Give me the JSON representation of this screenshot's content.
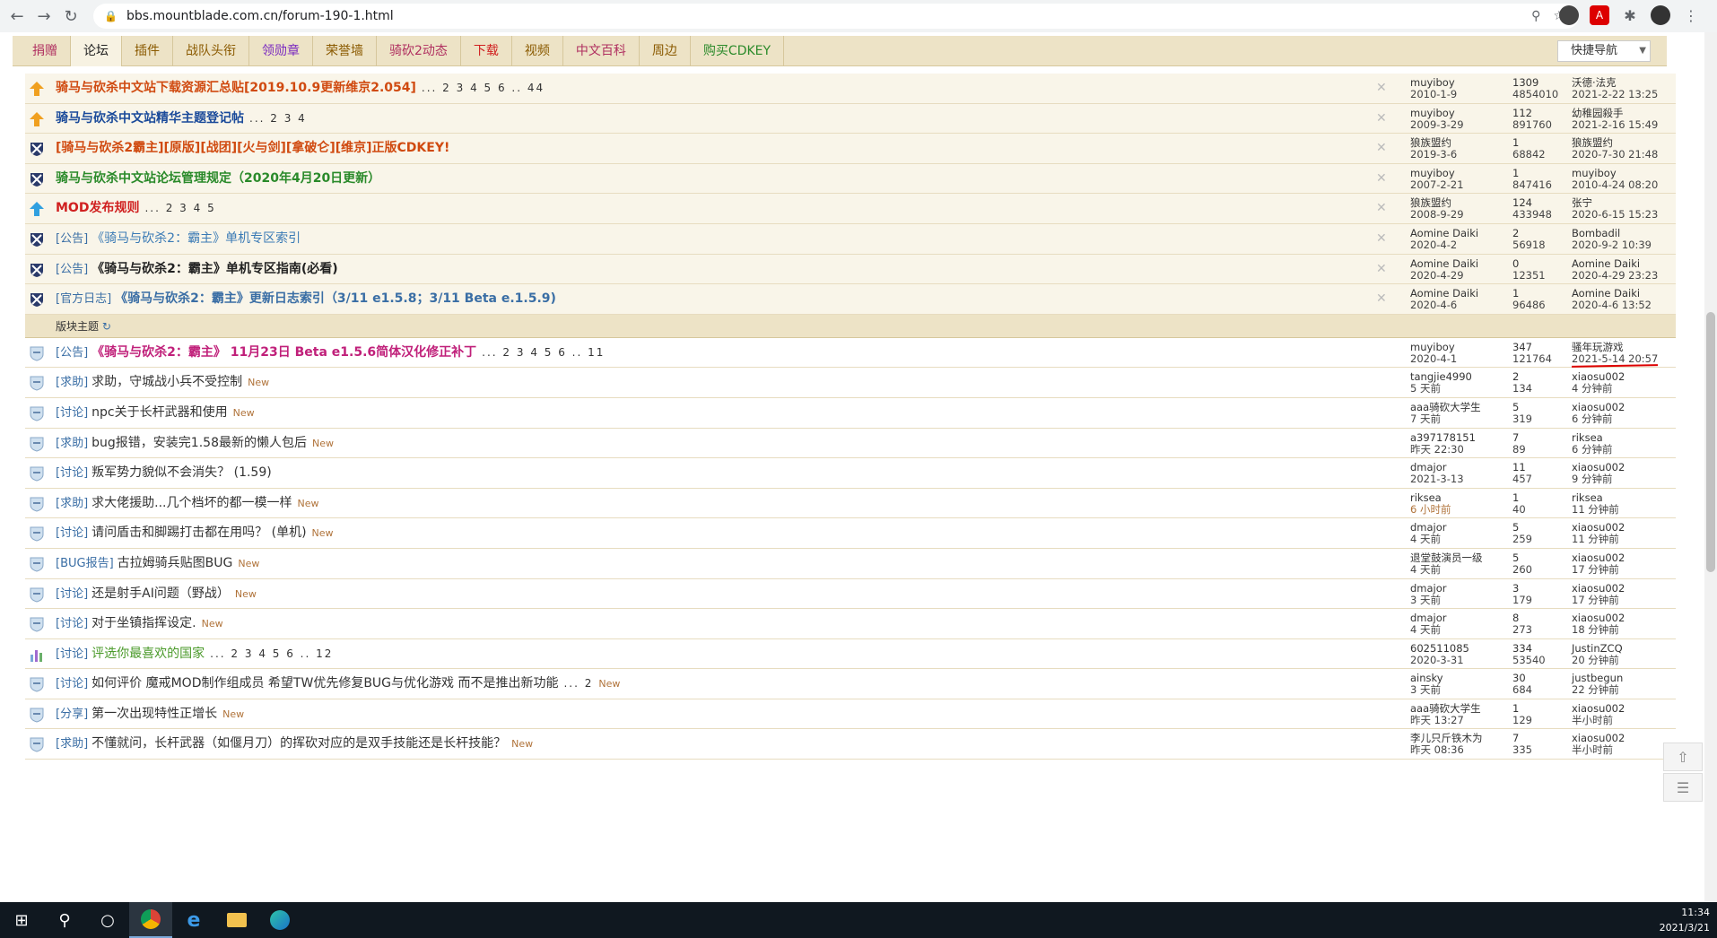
{
  "browser": {
    "url": "bbs.mountblade.com.cn/forum-190-1.html"
  },
  "topnav": {
    "items": [
      {
        "label": "捐赠",
        "color": "#b03060"
      },
      {
        "label": "论坛",
        "color": "#222222"
      },
      {
        "label": "插件",
        "color": "#8a5a00"
      },
      {
        "label": "战队头衔",
        "color": "#8a5a00"
      },
      {
        "label": "领勋章",
        "color": "#7a2ac0"
      },
      {
        "label": "荣誉墙",
        "color": "#8a5a00"
      },
      {
        "label": "骑砍2动态",
        "color": "#b03060"
      },
      {
        "label": "下载",
        "color": "#d02020"
      },
      {
        "label": "视频",
        "color": "#8a5a00"
      },
      {
        "label": "中文百科",
        "color": "#b03060"
      },
      {
        "label": "周边",
        "color": "#8a5a00"
      },
      {
        "label": "购买CDKEY",
        "color": "#2a8a2a"
      }
    ],
    "quick_nav": "快捷导航"
  },
  "sticky_threads": [
    {
      "title": "骑马与砍杀中文站下载资源汇总贴[2019.10.9更新维京2.054]",
      "title_color": "#d04a10",
      "bold": true,
      "pages": "... 2 3 4 5 6 .. 44",
      "author": "muyiboy",
      "date": "2010-1-9",
      "replies": "1309",
      "views": "4854010",
      "last_user": "沃德·法克",
      "last_time": "2021-2-22 13:25",
      "icon": "up-orange"
    },
    {
      "title": "骑马与砍杀中文站精华主题登记帖",
      "title_color": "#1a4a9a",
      "bold": true,
      "pages": "... 2 3 4",
      "author": "muyiboy",
      "date": "2009-3-29",
      "replies": "112",
      "views": "891760",
      "last_user": "幼稚园殺手",
      "last_time": "2021-2-16 15:49",
      "icon": "up-orange"
    },
    {
      "title": "[骑马与砍杀2霸主][原版][战团][火与剑][拿破仑][维京]正版CDKEY!",
      "title_color": "#d04a10",
      "bold": true,
      "pages": "",
      "author": "狼族盟约",
      "date": "2019-3-6",
      "replies": "1",
      "views": "68842",
      "last_user": "狼族盟约",
      "last_time": "2020-7-30 21:48",
      "icon": "shield-dark"
    },
    {
      "title": "骑马与砍杀中文站论坛管理规定（2020年4月20日更新）",
      "title_color": "#2a8a2a",
      "bold": true,
      "pages": "",
      "author": "muyiboy",
      "date": "2007-2-21",
      "replies": "1",
      "views": "847416",
      "last_user": "muyiboy",
      "last_time": "2010-4-24 08:20",
      "icon": "shield-dark"
    },
    {
      "title": "MOD发布规则",
      "title_color": "#d02020",
      "bold": true,
      "pages": "... 2 3 4 5",
      "author": "狼族盟约",
      "date": "2008-9-29",
      "replies": "124",
      "views": "433948",
      "last_user": "张宁",
      "last_time": "2020-6-15 15:23",
      "icon": "up-blue"
    },
    {
      "tag": "[公告]",
      "title": "《骑马与砍杀2：霸主》单机专区索引",
      "title_color": "#3a7ab5",
      "bold": false,
      "pages": "",
      "author": "Aomine Daiki",
      "date": "2020-4-2",
      "replies": "2",
      "views": "56918",
      "last_user": "Bombadil",
      "last_time": "2020-9-2 10:39",
      "icon": "shield-dark"
    },
    {
      "tag": "[公告]",
      "title": "《骑马与砍杀2：霸主》单机专区指南(必看)",
      "title_color": "#222222",
      "bold": true,
      "pages": "",
      "author": "Aomine Daiki",
      "date": "2020-4-29",
      "replies": "0",
      "views": "12351",
      "last_user": "Aomine Daiki",
      "last_time": "2020-4-29 23:23",
      "icon": "shield-dark"
    },
    {
      "tag": "[官方日志]",
      "title": "《骑马与砍杀2：霸主》更新日志索引（3/11 e1.5.8；3/11 Beta e.1.5.9)",
      "title_color": "#3a6ea5",
      "bold": true,
      "pages": "",
      "author": "Aomine Daiki",
      "date": "2020-4-6",
      "replies": "1",
      "views": "96486",
      "last_user": "Aomine Daiki",
      "last_time": "2020-4-6 13:52",
      "icon": "shield-dark"
    }
  ],
  "section_label": "版块主题",
  "threads": [
    {
      "tag": "[公告]",
      "title": "《骑马与砍杀2：霸主》 11月23日 Beta e1.5.6简体汉化修正补丁",
      "title_color": "#c0207a",
      "bold": true,
      "pages": "... 2 3 4 5 6 .. 11",
      "author": "muyiboy",
      "date": "2020-4-1",
      "date_orange": false,
      "replies": "347",
      "views": "121764",
      "last_user": "骚年玩游戏",
      "last_time": "2021-5-14 20:57",
      "new": "",
      "highlight_last": true
    },
    {
      "tag": "[求助]",
      "title": "求助，守城战小兵不受控制",
      "title_color": "#333333",
      "bold": false,
      "pages": "",
      "author": "tangjie4990",
      "date": "5 天前",
      "date_orange": false,
      "replies": "2",
      "views": "134",
      "last_user": "xiaosu002",
      "last_time": "4 分钟前",
      "new": "New"
    },
    {
      "tag": "[讨论]",
      "title": "npc关于长杆武器和使用",
      "title_color": "#333333",
      "bold": false,
      "pages": "",
      "author": "aaa骑砍大学生",
      "date": "7 天前",
      "date_orange": false,
      "replies": "5",
      "views": "319",
      "last_user": "xiaosu002",
      "last_time": "6 分钟前",
      "new": "New"
    },
    {
      "tag": "[求助]",
      "title": "bug报错，安装完1.58最新的懒人包后",
      "title_color": "#333333",
      "bold": false,
      "pages": "",
      "author": "a397178151",
      "date": "昨天 22:30",
      "date_orange": false,
      "replies": "7",
      "views": "89",
      "last_user": "riksea",
      "last_time": "6 分钟前",
      "new": "New"
    },
    {
      "tag": "[讨论]",
      "title": "叛军势力貌似不会消失？ (1.59)",
      "title_color": "#333333",
      "bold": false,
      "pages": "",
      "author": "dmajor",
      "date": "2021-3-13",
      "date_orange": false,
      "replies": "11",
      "views": "457",
      "last_user": "xiaosu002",
      "last_time": "9 分钟前",
      "new": ""
    },
    {
      "tag": "[求助]",
      "title": "求大佬援助...几个档坏的都一模一样",
      "title_color": "#333333",
      "bold": false,
      "pages": "",
      "author": "riksea",
      "date": "6 小时前",
      "date_orange": true,
      "replies": "1",
      "views": "40",
      "last_user": "riksea",
      "last_time": "11 分钟前",
      "new": "New"
    },
    {
      "tag": "[讨论]",
      "title": "请问盾击和脚踢打击都在用吗？ (单机)",
      "title_color": "#333333",
      "bold": false,
      "pages": "",
      "author": "dmajor",
      "date": "4 天前",
      "date_orange": false,
      "replies": "5",
      "views": "259",
      "last_user": "xiaosu002",
      "last_time": "11 分钟前",
      "new": "New"
    },
    {
      "tag": "[BUG报告]",
      "title": "古拉姆骑兵贴图BUG",
      "title_color": "#333333",
      "bold": false,
      "pages": "",
      "author": "退堂鼓演员一级",
      "date": "4 天前",
      "date_orange": false,
      "replies": "5",
      "views": "260",
      "last_user": "xiaosu002",
      "last_time": "17 分钟前",
      "new": "New"
    },
    {
      "tag": "[讨论]",
      "title": "还是射手AI问题（野战）",
      "title_color": "#333333",
      "bold": false,
      "pages": "",
      "author": "dmajor",
      "date": "3 天前",
      "date_orange": false,
      "replies": "3",
      "views": "179",
      "last_user": "xiaosu002",
      "last_time": "17 分钟前",
      "new": "New"
    },
    {
      "tag": "[讨论]",
      "title": "对于坐镇指挥设定.",
      "title_color": "#333333",
      "bold": false,
      "pages": "",
      "author": "dmajor",
      "date": "4 天前",
      "date_orange": false,
      "replies": "8",
      "views": "273",
      "last_user": "xiaosu002",
      "last_time": "18 分钟前",
      "new": "New"
    },
    {
      "tag": "[讨论]",
      "title": "评选你最喜欢的国家",
      "title_color": "#4a9a2a",
      "bold": false,
      "pages": "... 2 3 4 5 6 .. 12",
      "author": "602511085",
      "date": "2020-3-31",
      "date_orange": false,
      "replies": "334",
      "views": "53540",
      "last_user": "JustinZCQ",
      "last_time": "20 分钟前",
      "new": ""
    },
    {
      "tag": "[讨论]",
      "title": "如何评价 魔戒MOD制作组成员 希望TW优先修复BUG与优化游戏 而不是推出新功能",
      "title_color": "#333333",
      "bold": false,
      "pages": "... 2",
      "author": "ainsky",
      "date": "3 天前",
      "date_orange": false,
      "replies": "30",
      "views": "684",
      "last_user": "justbegun",
      "last_time": "22 分钟前",
      "new": "New"
    },
    {
      "tag": "[分享]",
      "title": "第一次出现特性正增长",
      "title_color": "#333333",
      "bold": false,
      "pages": "",
      "author": "aaa骑砍大学生",
      "date": "昨天 13:27",
      "date_orange": false,
      "replies": "1",
      "views": "129",
      "last_user": "xiaosu002",
      "last_time": "半小时前",
      "new": "New"
    },
    {
      "tag": "[求助]",
      "title": "不懂就问，长杆武器（如偃月刀）的挥砍对应的是双手技能还是长杆技能？",
      "title_color": "#333333",
      "bold": false,
      "pages": "",
      "author": "李儿只斤铁木为",
      "date": "昨天 08:36",
      "date_orange": false,
      "replies": "7",
      "views": "335",
      "last_user": "xiaosu002",
      "last_time": "半小时前",
      "new": "New"
    }
  ],
  "taskbar": {
    "time": "11:34",
    "date": "2021/3/21"
  }
}
